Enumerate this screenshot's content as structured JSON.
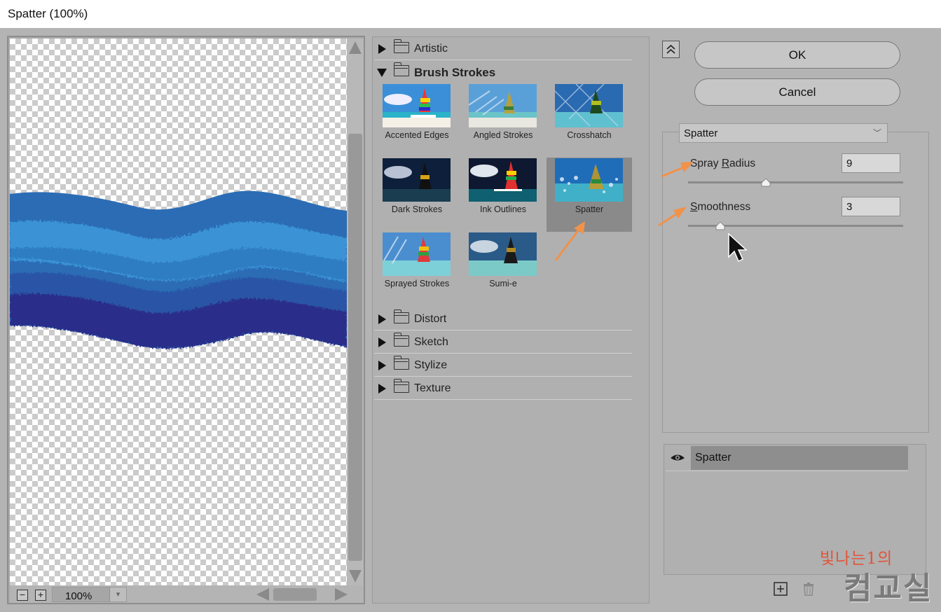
{
  "window": {
    "title": "Spatter (100%)"
  },
  "preview": {
    "zoom_value": "100%"
  },
  "gallery": {
    "categories_top": [
      {
        "label": "Artistic",
        "expanded": false
      },
      {
        "label": "Brush Strokes",
        "expanded": true
      }
    ],
    "brush_strokes": [
      {
        "label": "Accented Edges",
        "selected": false
      },
      {
        "label": "Angled Strokes",
        "selected": false
      },
      {
        "label": "Crosshatch",
        "selected": false
      },
      {
        "label": "Dark Strokes",
        "selected": false
      },
      {
        "label": "Ink Outlines",
        "selected": false
      },
      {
        "label": "Spatter",
        "selected": true
      },
      {
        "label": "Sprayed Strokes",
        "selected": false
      },
      {
        "label": "Sumi-e",
        "selected": false
      }
    ],
    "categories_bottom": [
      {
        "label": "Distort",
        "expanded": false
      },
      {
        "label": "Sketch",
        "expanded": false
      },
      {
        "label": "Stylize",
        "expanded": false
      },
      {
        "label": "Texture",
        "expanded": false
      }
    ]
  },
  "buttons": {
    "ok": "OK",
    "cancel": "Cancel"
  },
  "settings": {
    "filter_select": "Spatter",
    "spray_radius": {
      "label_pre": "Spray ",
      "label_mnemonic": "R",
      "label_post": "adius",
      "value": "9",
      "slider_fraction": 0.36
    },
    "smoothness": {
      "label_mnemonic": "S",
      "label_post": "moothness",
      "value": "3",
      "slider_fraction": 0.15
    }
  },
  "layers": {
    "items": [
      {
        "name": "Spatter",
        "visible": true
      }
    ]
  },
  "watermark": {
    "line1": "빛나는1의",
    "line2": "컴교실"
  },
  "colors": {
    "annotation_arrow": "#f0924a",
    "selected_thumb_bg": "#8a8a8a",
    "wave_top": "#2b6cb5",
    "wave_mid": "#3a93d6",
    "wave_bottom": "#2c2f8a"
  }
}
